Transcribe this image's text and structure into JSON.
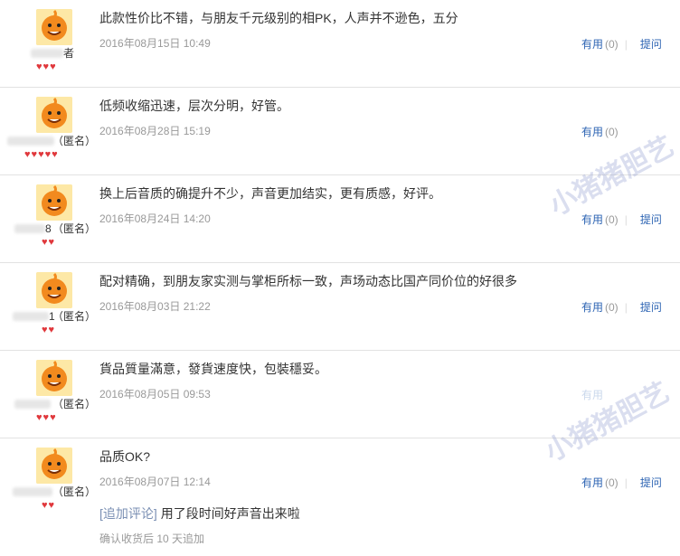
{
  "labels": {
    "useful": "有用",
    "ask": "提问",
    "anon": "（匿名）",
    "append_tag": "[追加评论]"
  },
  "reviews": [
    {
      "content": "此款性价比不错，与朋友千元级别的相PK，人声并不逊色，五分",
      "date": "2016年08月15日 10:49",
      "useful_count": "(0)",
      "anonymous": false,
      "user_suffix": "者",
      "hearts": 3
    },
    {
      "content": "低频收缩迅速，层次分明，好管。",
      "date": "2016年08月28日 15:19",
      "useful_count": "(0)",
      "anonymous": true,
      "hearts": 5
    },
    {
      "content": "换上后音质的确提升不少，声音更加结实，更有质感，好评。",
      "date": "2016年08月24日 14:20",
      "useful_count": "(0)",
      "anonymous": true,
      "user_suffix": "8",
      "hearts": 2
    },
    {
      "content": "配对精确，到朋友家实测与掌柜所标一致，声场动态比国产同价位的好很多",
      "date": "2016年08月03日 21:22",
      "useful_count": "(0)",
      "anonymous": true,
      "user_suffix": "1",
      "hearts": 2
    },
    {
      "content": "貨品質量滿意，發貨速度快，包裝穩妥。",
      "date": "2016年08月05日 09:53",
      "useful_count": "",
      "anonymous": true,
      "hearts": 3
    },
    {
      "content": "品质OK?",
      "date": "2016年08月07日 12:14",
      "useful_count": "(0)",
      "anonymous": true,
      "hearts": 2,
      "append": "用了段时间好声音出来啦",
      "confirm": "确认收货后 10 天追加"
    }
  ],
  "watermark": "小猪猪胆艺",
  "colors": {
    "link": "#2d64b3",
    "muted": "#999999",
    "heart": "#e0383c",
    "divider": "#e2e2e2"
  },
  "icons": {
    "avatar": "orange-mascot-avatar-icon",
    "heart": "heart-icon"
  }
}
